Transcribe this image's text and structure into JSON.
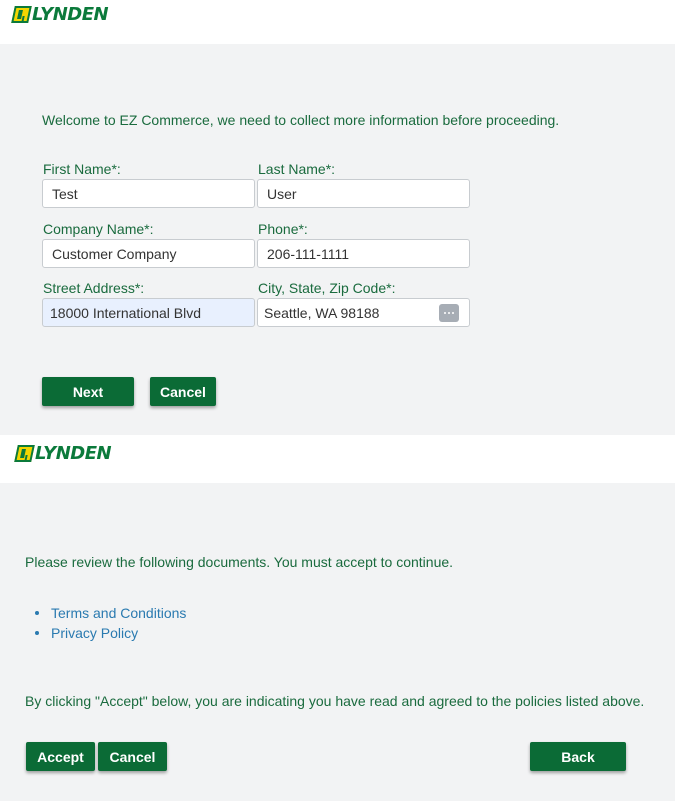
{
  "brand": {
    "logo_text": "LYNDEN",
    "accent": "#0b6b36",
    "logo_yellow": "#f2d600"
  },
  "info_form": {
    "intro": "Welcome to EZ Commerce, we need to collect more information before proceeding.",
    "first_name": {
      "label": "First Name*:",
      "value": "Test"
    },
    "last_name": {
      "label": "Last Name*:",
      "value": "User"
    },
    "company_name": {
      "label": "Company Name*:",
      "value": "Customer Company"
    },
    "phone": {
      "label": "Phone*:",
      "value": "206-111-1111"
    },
    "street_address": {
      "label": "Street Address*:",
      "value": "18000 International Blvd"
    },
    "city_state_zip": {
      "label": "City, State, Zip Code*:",
      "value": "Seattle, WA 98188",
      "icon": "more-dots-icon"
    },
    "next_label": "Next",
    "cancel_label": "Cancel"
  },
  "review": {
    "intro": "Please review the following documents. You must accept to continue.",
    "documents": [
      {
        "label": "Terms and Conditions"
      },
      {
        "label": "Privacy Policy"
      }
    ],
    "consent": "By clicking \"Accept\" below, you are indicating you have read and agreed to the policies listed above.",
    "accept_label": "Accept",
    "cancel_label": "Cancel",
    "back_label": "Back"
  }
}
